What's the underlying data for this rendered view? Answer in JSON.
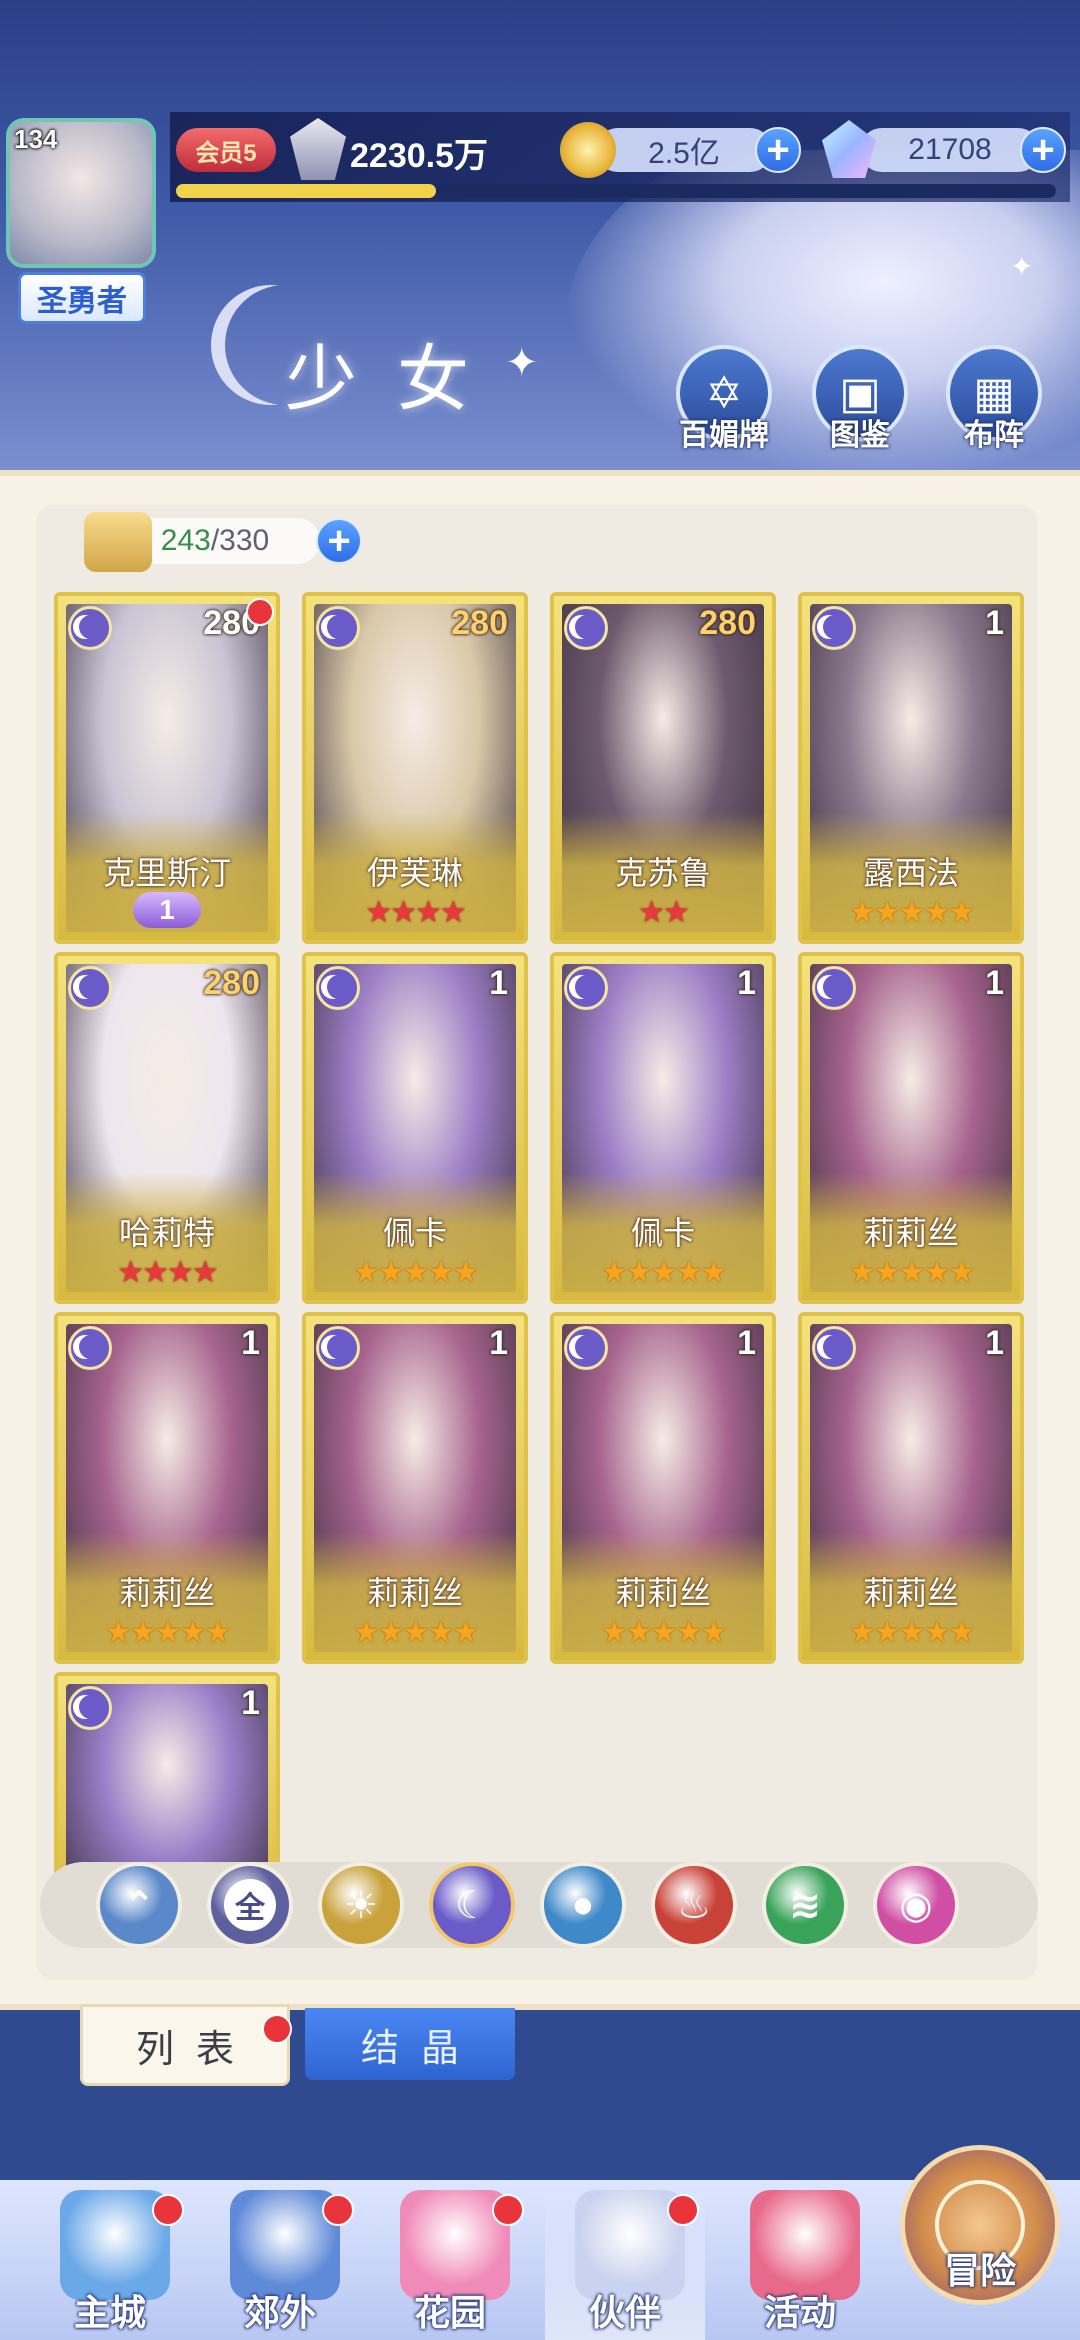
{
  "player": {
    "level": "134",
    "title": "圣勇者",
    "vip": "会员5",
    "power": "2230.5万",
    "exp_fraction": 0.296
  },
  "resources": {
    "gold": "2.5亿",
    "gems": "21708",
    "plus": "+"
  },
  "header": {
    "title": "少女",
    "buttons": [
      "百媚牌",
      "图鉴",
      "布阵"
    ]
  },
  "roster": {
    "count": "243",
    "separator": "/",
    "capacity": "330",
    "plus": "+"
  },
  "cards": [
    {
      "name": "克里斯汀",
      "level": "280",
      "stars": 0,
      "star_color": "gold",
      "badge": "1",
      "new": true,
      "art": "#c9c4d4"
    },
    {
      "name": "伊芙琳",
      "level": "280",
      "stars": 4,
      "star_color": "red",
      "badge": "",
      "new": false,
      "art": "#d9c8a8"
    },
    {
      "name": "克苏鲁",
      "level": "280",
      "stars": 2,
      "star_color": "red",
      "badge": "",
      "new": false,
      "art": "#6e5a6e"
    },
    {
      "name": "露西法",
      "level": "1",
      "stars": 5,
      "star_color": "gold",
      "badge": "",
      "new": false,
      "art": "#8a7a8e"
    },
    {
      "name": "哈莉特",
      "level": "280",
      "stars": 4,
      "star_color": "red",
      "badge": "",
      "new": false,
      "art": "#ede6ee"
    },
    {
      "name": "佩卡",
      "level": "1",
      "stars": 5,
      "star_color": "gold",
      "badge": "",
      "new": false,
      "art": "#9c7ec6"
    },
    {
      "name": "佩卡",
      "level": "1",
      "stars": 5,
      "star_color": "gold",
      "badge": "",
      "new": false,
      "art": "#9c7ec6"
    },
    {
      "name": "莉莉丝",
      "level": "1",
      "stars": 5,
      "star_color": "gold",
      "badge": "",
      "new": false,
      "art": "#a7648e"
    },
    {
      "name": "莉莉丝",
      "level": "1",
      "stars": 5,
      "star_color": "gold",
      "badge": "",
      "new": false,
      "art": "#a7648e"
    },
    {
      "name": "莉莉丝",
      "level": "1",
      "stars": 5,
      "star_color": "gold",
      "badge": "",
      "new": false,
      "art": "#a7648e"
    },
    {
      "name": "莉莉丝",
      "level": "1",
      "stars": 5,
      "star_color": "gold",
      "badge": "",
      "new": false,
      "art": "#a7648e"
    },
    {
      "name": "莉莉丝",
      "level": "1",
      "stars": 5,
      "star_color": "gold",
      "badge": "",
      "new": false,
      "art": "#a7648e"
    },
    {
      "name": "",
      "level": "1",
      "stars": 0,
      "star_color": "gold",
      "badge": "",
      "new": false,
      "art": "#9a7fc9",
      "partial": true
    }
  ],
  "filters": [
    {
      "icon": "wind-wing-icon",
      "label": "",
      "color": "#5a88c8"
    },
    {
      "icon": "all-icon",
      "label": "全",
      "color": "#5d5f9e"
    },
    {
      "icon": "sun-icon",
      "label": "",
      "color": "#c9a23c"
    },
    {
      "icon": "moon-icon",
      "label": "",
      "color": "#6a5bc8",
      "active": true
    },
    {
      "icon": "water-icon",
      "label": "",
      "color": "#3f89c9"
    },
    {
      "icon": "fire-icon",
      "label": "",
      "color": "#c94238"
    },
    {
      "icon": "tornado-icon",
      "label": "",
      "color": "#3aa35a"
    },
    {
      "icon": "orb-icon",
      "label": "",
      "color": "#d04fa4"
    }
  ],
  "tabs": {
    "list": "列表",
    "crystal": "结晶"
  },
  "nav": [
    {
      "label": "主城",
      "icon": "castle-icon",
      "dot": true,
      "color": "#6aa8e8"
    },
    {
      "label": "郊外",
      "icon": "portal-icon",
      "dot": true,
      "color": "#5f8ad8"
    },
    {
      "label": "花园",
      "icon": "heart-icon",
      "dot": true,
      "color": "#f08ab8"
    },
    {
      "label": "伙伴",
      "icon": "partner-icon",
      "dot": true,
      "color": "#c9d2ee"
    },
    {
      "label": "活动",
      "icon": "gift-icon",
      "dot": false,
      "color": "#e86a8a"
    },
    {
      "label": "冒险",
      "icon": "compass-icon",
      "dot": false,
      "color": "#d08a4a"
    }
  ]
}
